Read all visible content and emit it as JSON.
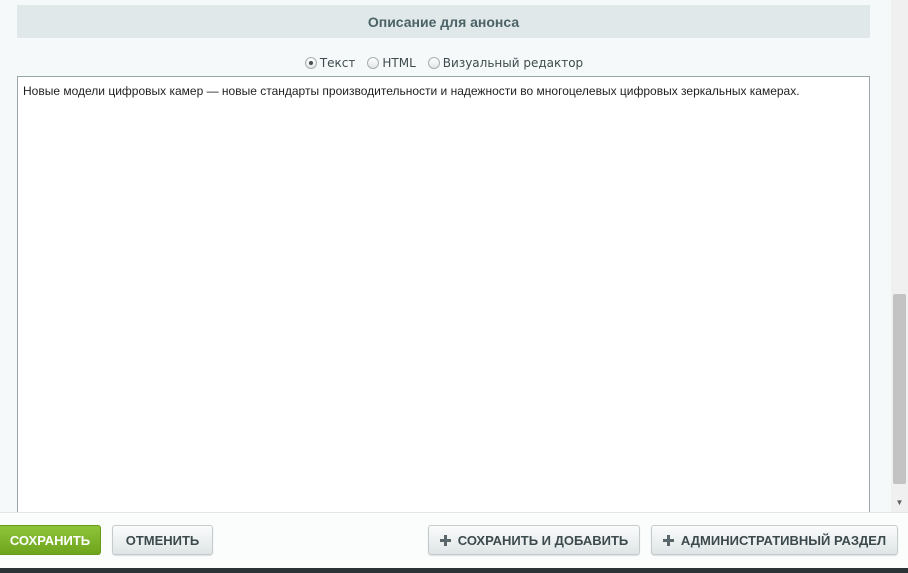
{
  "section": {
    "title": "Описание для анонса"
  },
  "editor_mode": {
    "options": [
      {
        "label": "Текст",
        "checked": true
      },
      {
        "label": "HTML",
        "checked": false
      },
      {
        "label": "Визуальный редактор",
        "checked": false
      }
    ]
  },
  "editor": {
    "value": "Новые модели цифровых камер — новые стандарты производительности и надежности во многоцелевых цифровых зеркальных камерах."
  },
  "buttons": {
    "save": "СОХРАНИТЬ",
    "cancel": "ОТМЕНИТЬ",
    "save_and_add": "СОХРАНИТЬ И ДОБАВИТЬ",
    "admin_section": "АДМИНИСТРАТИВНЫЙ РАЗДЕЛ"
  },
  "colors": {
    "save_button": "#7ab32a",
    "header_bg": "#e0e8ea"
  }
}
